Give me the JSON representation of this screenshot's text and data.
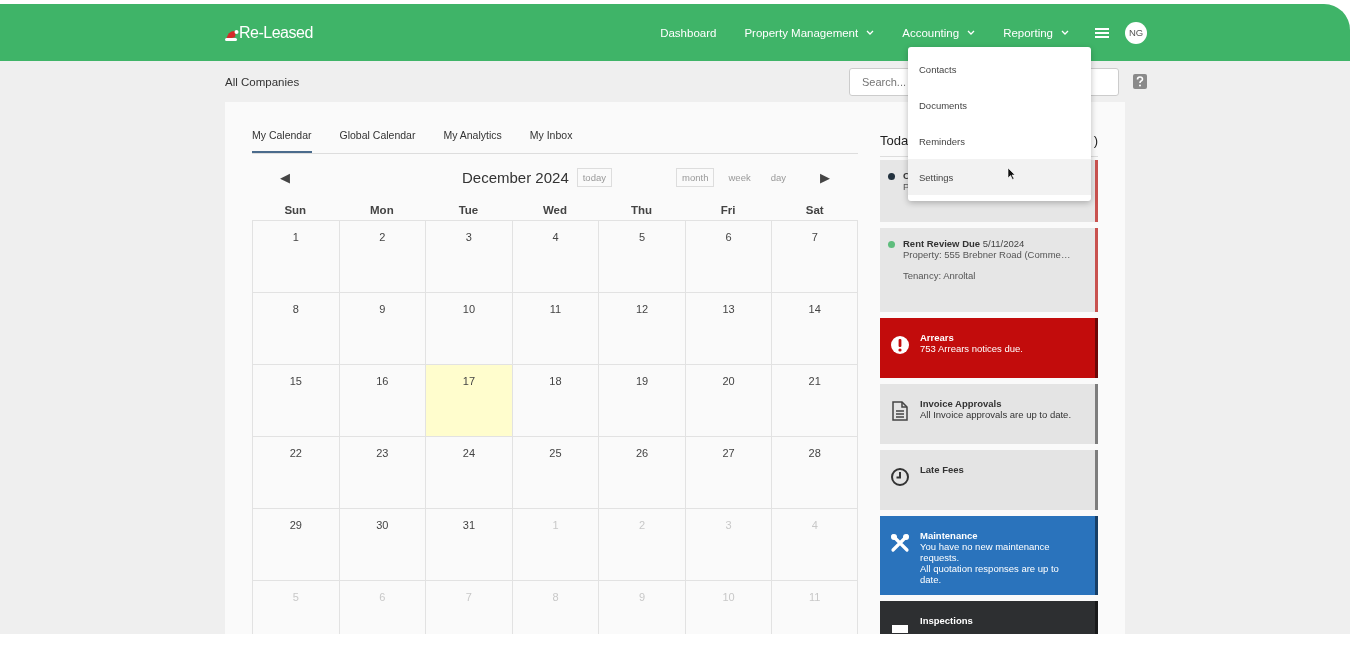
{
  "header": {
    "logo": "Re-Leased",
    "nav": [
      {
        "label": "Dashboard",
        "dropdown": false
      },
      {
        "label": "Property Management",
        "dropdown": true
      },
      {
        "label": "Accounting",
        "dropdown": true
      },
      {
        "label": "Reporting",
        "dropdown": true
      }
    ],
    "avatar": "NG"
  },
  "menu": [
    {
      "label": "Contacts",
      "hovered": false
    },
    {
      "label": "Documents",
      "hovered": false
    },
    {
      "label": "Reminders",
      "hovered": false
    },
    {
      "label": "Settings",
      "hovered": true
    }
  ],
  "breadcrumb": "All Companies",
  "search": {
    "placeholder": "Search..."
  },
  "tabs": [
    {
      "label": "My Calendar",
      "selected": true
    },
    {
      "label": "Global Calendar",
      "selected": false
    },
    {
      "label": "My Analytics",
      "selected": false
    },
    {
      "label": "My Inbox",
      "selected": false
    }
  ],
  "calendar": {
    "prev": "◀",
    "title": "December 2024",
    "today": "today",
    "views": [
      {
        "label": "month",
        "selected": true
      },
      {
        "label": "week",
        "selected": false
      },
      {
        "label": "day",
        "selected": false
      }
    ],
    "next": "▶",
    "weekdays": [
      "Sun",
      "Mon",
      "Tue",
      "Wed",
      "Thu",
      "Fri",
      "Sat"
    ],
    "weeks": [
      [
        {
          "day": "1",
          "other": false,
          "today": false
        },
        {
          "day": "2",
          "other": false,
          "today": false
        },
        {
          "day": "3",
          "other": false,
          "today": false
        },
        {
          "day": "4",
          "other": false,
          "today": false
        },
        {
          "day": "5",
          "other": false,
          "today": false
        },
        {
          "day": "6",
          "other": false,
          "today": false
        },
        {
          "day": "7",
          "other": false,
          "today": false
        }
      ],
      [
        {
          "day": "8",
          "other": false,
          "today": false
        },
        {
          "day": "9",
          "other": false,
          "today": false
        },
        {
          "day": "10",
          "other": false,
          "today": false
        },
        {
          "day": "11",
          "other": false,
          "today": false
        },
        {
          "day": "12",
          "other": false,
          "today": false
        },
        {
          "day": "13",
          "other": false,
          "today": false
        },
        {
          "day": "14",
          "other": false,
          "today": false
        }
      ],
      [
        {
          "day": "15",
          "other": false,
          "today": false
        },
        {
          "day": "16",
          "other": false,
          "today": false
        },
        {
          "day": "17",
          "other": false,
          "today": true
        },
        {
          "day": "18",
          "other": false,
          "today": false
        },
        {
          "day": "19",
          "other": false,
          "today": false
        },
        {
          "day": "20",
          "other": false,
          "today": false
        },
        {
          "day": "21",
          "other": false,
          "today": false
        }
      ],
      [
        {
          "day": "22",
          "other": false,
          "today": false
        },
        {
          "day": "23",
          "other": false,
          "today": false
        },
        {
          "day": "24",
          "other": false,
          "today": false
        },
        {
          "day": "25",
          "other": false,
          "today": false
        },
        {
          "day": "26",
          "other": false,
          "today": false
        },
        {
          "day": "27",
          "other": false,
          "today": false
        },
        {
          "day": "28",
          "other": false,
          "today": false
        }
      ],
      [
        {
          "day": "29",
          "other": false,
          "today": false
        },
        {
          "day": "30",
          "other": false,
          "today": false
        },
        {
          "day": "31",
          "other": false,
          "today": false
        },
        {
          "day": "1",
          "other": true,
          "today": false
        },
        {
          "day": "2",
          "other": true,
          "today": false
        },
        {
          "day": "3",
          "other": true,
          "today": false
        },
        {
          "day": "4",
          "other": true,
          "today": false
        }
      ],
      [
        {
          "day": "5",
          "other": true,
          "today": false
        },
        {
          "day": "6",
          "other": true,
          "today": false
        },
        {
          "day": "7",
          "other": true,
          "today": false
        },
        {
          "day": "8",
          "other": true,
          "today": false
        },
        {
          "day": "9",
          "other": true,
          "today": false
        },
        {
          "day": "10",
          "other": true,
          "today": false
        },
        {
          "day": "11",
          "other": true,
          "today": false
        }
      ]
    ]
  },
  "today_panel": {
    "title_start": "Toda",
    "title_end": ")",
    "events": [
      {
        "title": "C",
        "lines": [
          "P"
        ],
        "color": "#23323f"
      },
      {
        "title": "Rent Review Due",
        "date": "5/11/2024",
        "lines": [
          "Property: 555 Brebner Road (Comme…",
          "Tenancy: Anroltal"
        ],
        "color": "#5fbd7d"
      }
    ],
    "alerts": [
      {
        "title": "Arrears",
        "lines": [
          "753 Arrears notices due."
        ],
        "color": "#c20c0c"
      },
      {
        "title": "Invoice Approvals",
        "lines": [
          "All Invoice approvals are up to date."
        ],
        "color": "#e4e4e4"
      },
      {
        "title": "Late Fees",
        "color": "#e4e4e4"
      },
      {
        "title": "Maintenance",
        "lines": [
          "You have no new maintenance requests.",
          "All quotation responses are up to date."
        ],
        "color": "#2a73bc"
      },
      {
        "title": "Inspections",
        "color": "#2d2f31"
      }
    ]
  }
}
